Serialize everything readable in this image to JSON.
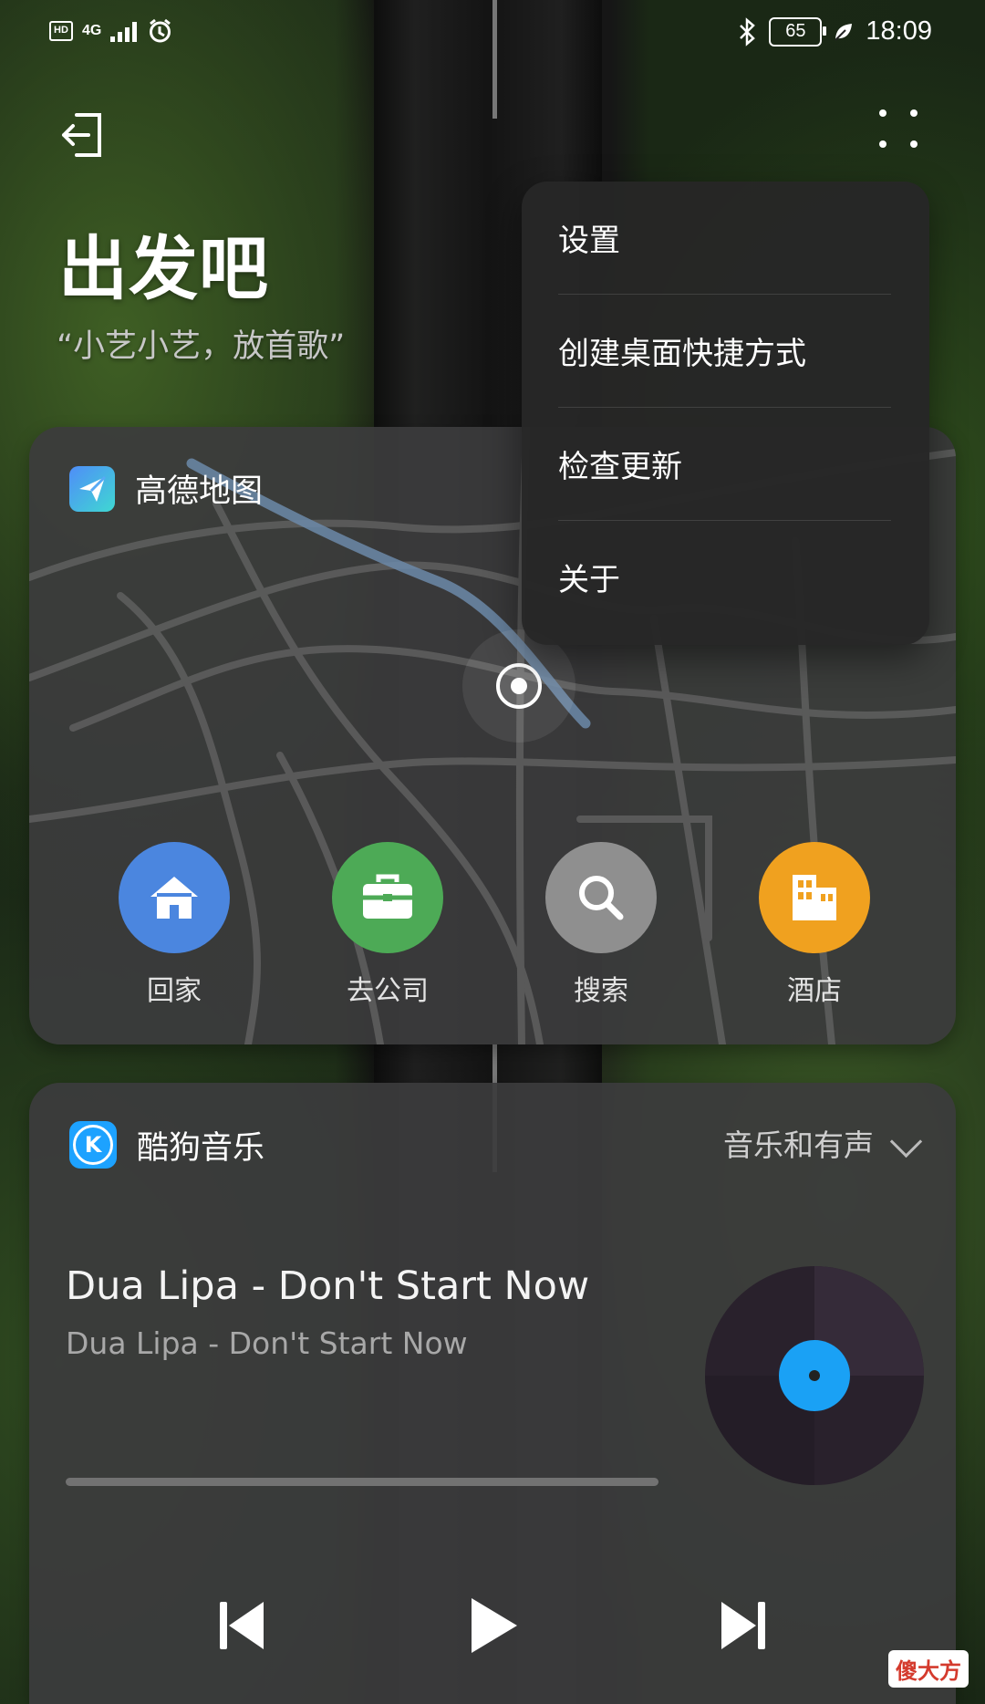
{
  "status_bar": {
    "hd_label": "HD",
    "network": "4G",
    "battery": "65",
    "time": "18:09"
  },
  "header": {
    "title": "出发吧",
    "subtitle": "“小艺小艺，放首歌”"
  },
  "map_card": {
    "app_name": "高德地图",
    "shortcuts": [
      {
        "label": "回家",
        "color": "#4b86df",
        "icon": "home-icon"
      },
      {
        "label": "去公司",
        "color": "#4daa56",
        "icon": "briefcase-icon"
      },
      {
        "label": "搜索",
        "color": "#8f8f8f",
        "icon": "search-icon"
      },
      {
        "label": "酒店",
        "color": "#f0a11f",
        "icon": "hotel-icon"
      }
    ]
  },
  "music_card": {
    "app_name": "酷狗音乐",
    "tab_label": "音乐和有声",
    "song_title": "Dua Lipa - Don't Start Now",
    "song_subtitle": "Dua Lipa - Don't Start Now",
    "progress": 0,
    "accent_color": "#1a9bf0"
  },
  "menu": {
    "items": [
      "设置",
      "创建桌面快捷方式",
      "检查更新",
      "关于"
    ]
  },
  "watermark": "傻大方"
}
